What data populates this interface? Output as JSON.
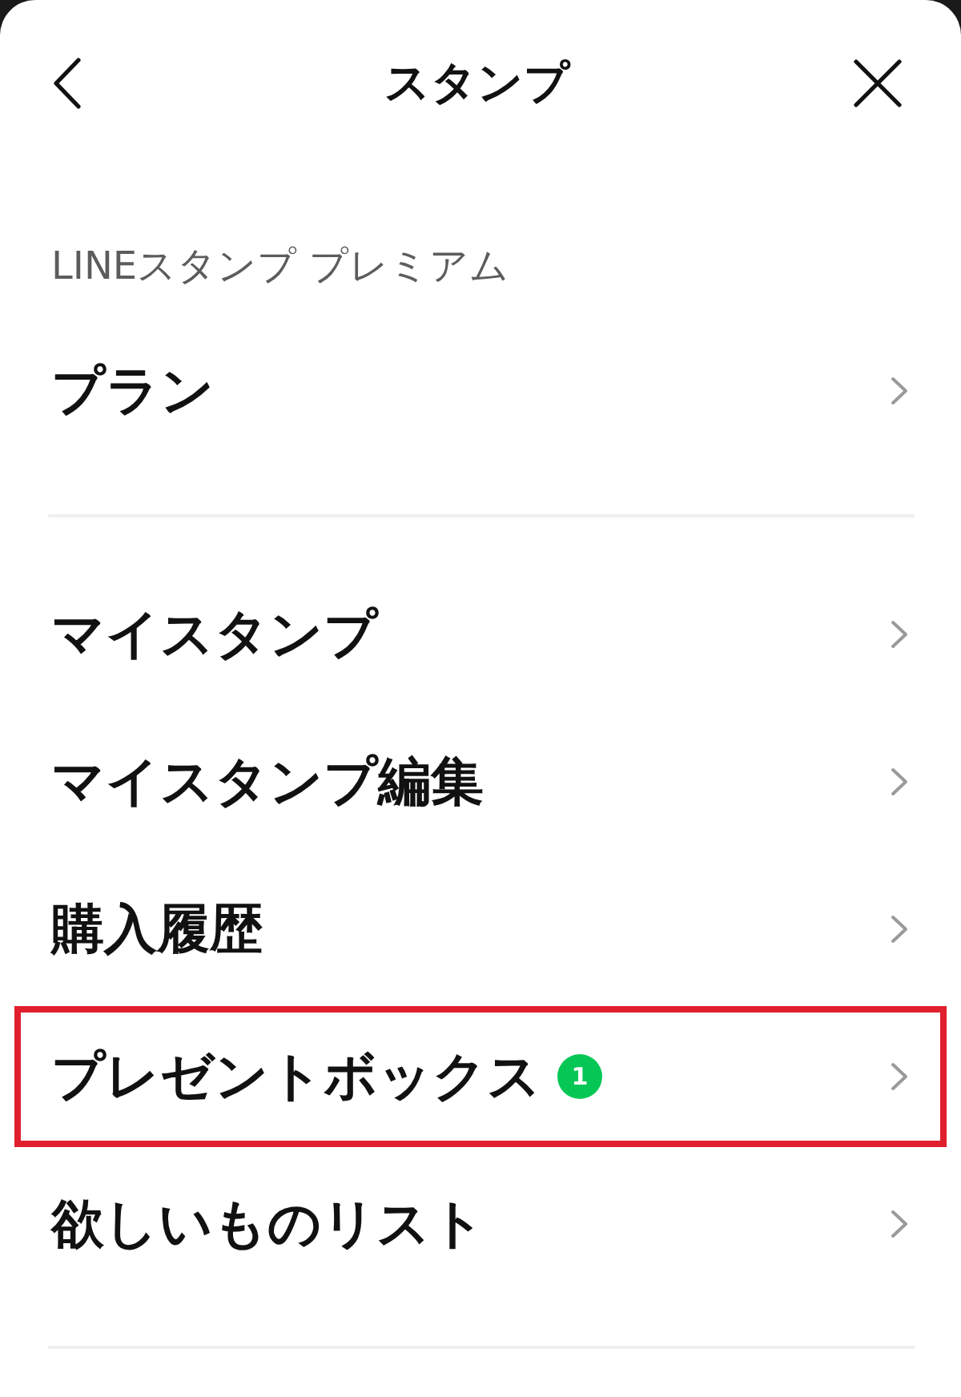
{
  "header": {
    "title": "スタンプ"
  },
  "sections": [
    {
      "label": "LINEスタンプ プレミアム",
      "items": [
        {
          "label": "プラン",
          "highlighted": false
        }
      ]
    },
    {
      "items": [
        {
          "label": "マイスタンプ",
          "highlighted": false
        },
        {
          "label": "マイスタンプ編集",
          "highlighted": false
        },
        {
          "label": "購入履歴",
          "highlighted": false
        },
        {
          "label": "プレゼントボックス",
          "badge": "1",
          "highlighted": true
        },
        {
          "label": "欲しいものリスト",
          "highlighted": false
        }
      ]
    }
  ]
}
